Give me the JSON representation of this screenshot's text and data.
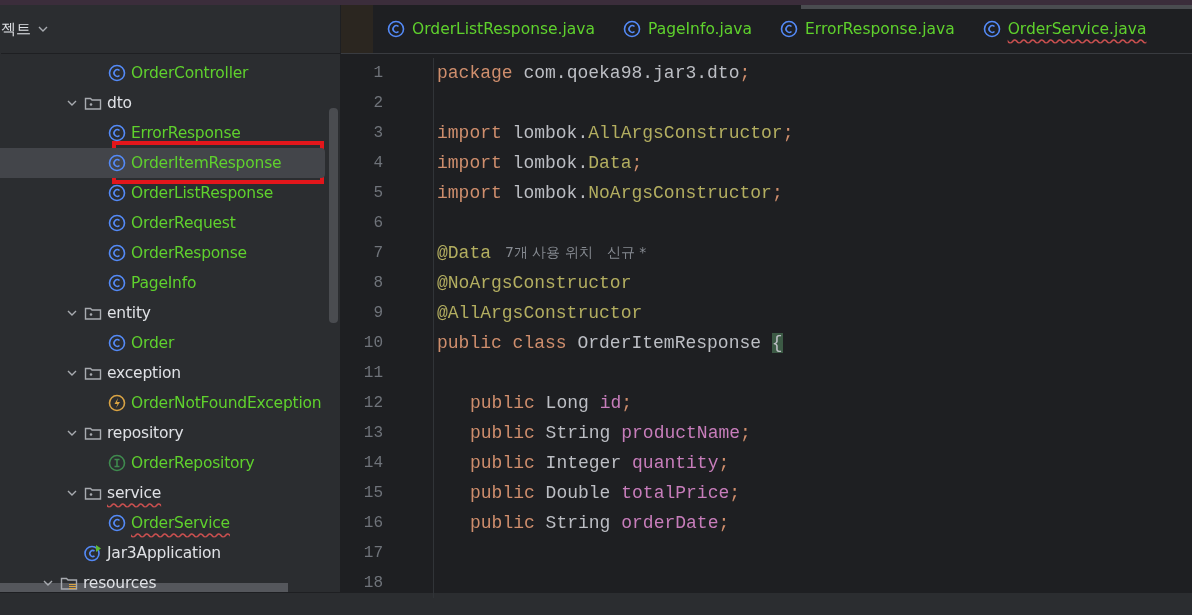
{
  "project_panel": {
    "title": "젝트",
    "tree": [
      {
        "children": [
          {
            "children": [
              {
                "kind": "class",
                "label": "OrderController",
                "selected": false
              }
            ]
          },
          {
            "kind": "folder",
            "label": "dto",
            "expanded": true,
            "children": [
              {
                "kind": "class",
                "label": "ErrorResponse",
                "selected": false
              },
              {
                "kind": "class",
                "label": "OrderItemResponse",
                "selected": true,
                "highlighted": true
              },
              {
                "kind": "class",
                "label": "OrderListResponse",
                "selected": false
              },
              {
                "kind": "class",
                "label": "OrderRequest",
                "selected": false
              },
              {
                "kind": "class",
                "label": "OrderResponse",
                "selected": false
              },
              {
                "kind": "class",
                "label": "PageInfo",
                "selected": false
              }
            ]
          },
          {
            "kind": "folder",
            "label": "entity",
            "expanded": true,
            "children": [
              {
                "kind": "class",
                "label": "Order",
                "selected": false
              }
            ]
          },
          {
            "kind": "folder",
            "label": "exception",
            "expanded": true,
            "children": [
              {
                "kind": "exception",
                "label": "OrderNotFoundException",
                "selected": false
              }
            ]
          },
          {
            "kind": "folder",
            "label": "repository",
            "expanded": true,
            "children": [
              {
                "kind": "interface",
                "label": "OrderRepository",
                "selected": false
              }
            ]
          },
          {
            "kind": "folder",
            "label": "service",
            "expanded": true,
            "underlined": true,
            "children": [
              {
                "kind": "class",
                "label": "OrderService",
                "selected": false,
                "underlined": true
              }
            ]
          },
          {
            "kind": "app",
            "label": "Jar3Application",
            "selected": false
          }
        ]
      },
      {
        "kind": "resources",
        "label": "resources",
        "expanded": true
      }
    ]
  },
  "tabs": [
    {
      "label": "OrderListResponse.java",
      "selected": false
    },
    {
      "label": "PageInfo.java",
      "selected": false
    },
    {
      "label": "ErrorResponse.java",
      "selected": false
    },
    {
      "label": "OrderService.java",
      "selected": false,
      "underlined": true
    }
  ],
  "code_lines": [
    {
      "number": "1",
      "tokens": [
        {
          "kind": "keyword",
          "text": "package"
        },
        {
          "kind": "plain",
          "text": " com.qoeka98.jar3.dto"
        },
        {
          "kind": "punct",
          "text": ";"
        }
      ]
    },
    {
      "number": "2"
    },
    {
      "number": "3",
      "tokens": [
        {
          "kind": "keyword",
          "text": "import"
        },
        {
          "kind": "plain",
          "text": " lombok."
        },
        {
          "kind": "annotation",
          "text": "AllArgsConstructor"
        },
        {
          "kind": "punct",
          "text": ";"
        }
      ]
    },
    {
      "number": "4",
      "tokens": [
        {
          "kind": "keyword",
          "text": "import"
        },
        {
          "kind": "plain",
          "text": " lombok."
        },
        {
          "kind": "annotation",
          "text": "Data"
        },
        {
          "kind": "punct",
          "text": ";"
        }
      ]
    },
    {
      "number": "5",
      "tokens": [
        {
          "kind": "keyword",
          "text": "import"
        },
        {
          "kind": "plain",
          "text": " lombok."
        },
        {
          "kind": "annotation",
          "text": "NoArgsConstructor"
        },
        {
          "kind": "punct",
          "text": ";"
        }
      ]
    },
    {
      "number": "6"
    },
    {
      "number": "7",
      "tokens": [
        {
          "kind": "annotation",
          "text": "@Data"
        },
        {
          "kind": "hint",
          "text": "7개 사용 위치"
        },
        {
          "kind": "hint",
          "text": "신규 *"
        }
      ]
    },
    {
      "number": "8",
      "tokens": [
        {
          "kind": "annotation",
          "text": "@NoArgsConstructor"
        }
      ]
    },
    {
      "number": "9",
      "tokens": [
        {
          "kind": "annotation",
          "text": "@AllArgsConstructor"
        }
      ]
    },
    {
      "number": "10",
      "tokens": [
        {
          "kind": "keyword",
          "text": "public class"
        },
        {
          "kind": "plain",
          "text": " OrderItemResponse "
        },
        {
          "kind": "brace",
          "text": "{"
        }
      ]
    },
    {
      "number": "11"
    },
    {
      "number": "12",
      "indented": true,
      "tokens": [
        {
          "kind": "keyword",
          "text": "public"
        },
        {
          "kind": "plain",
          "text": " Long "
        },
        {
          "kind": "field",
          "text": "id"
        },
        {
          "kind": "punct",
          "text": ";"
        }
      ]
    },
    {
      "number": "13",
      "indented": true,
      "tokens": [
        {
          "kind": "keyword",
          "text": "public"
        },
        {
          "kind": "plain",
          "text": " String "
        },
        {
          "kind": "field",
          "text": "productName"
        },
        {
          "kind": "punct",
          "text": ";"
        }
      ]
    },
    {
      "number": "14",
      "indented": true,
      "tokens": [
        {
          "kind": "keyword",
          "text": "public"
        },
        {
          "kind": "plain",
          "text": " Integer "
        },
        {
          "kind": "field",
          "text": "quantity"
        },
        {
          "kind": "punct",
          "text": ";"
        }
      ]
    },
    {
      "number": "15",
      "indented": true,
      "tokens": [
        {
          "kind": "keyword",
          "text": "public"
        },
        {
          "kind": "plain",
          "text": " Double "
        },
        {
          "kind": "field",
          "text": "totalPrice"
        },
        {
          "kind": "punct",
          "text": ";"
        }
      ]
    },
    {
      "number": "16",
      "indented": true,
      "tokens": [
        {
          "kind": "keyword",
          "text": "public"
        },
        {
          "kind": "plain",
          "text": " String "
        },
        {
          "kind": "field",
          "text": "orderDate"
        },
        {
          "kind": "punct",
          "text": ";"
        }
      ]
    },
    {
      "number": "17"
    },
    {
      "number": "18"
    }
  ]
}
